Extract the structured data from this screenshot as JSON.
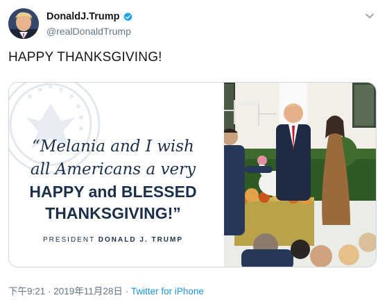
{
  "tweet": {
    "author": {
      "display_name": "DonaldJ.Trump",
      "handle": "@realDonaldTrump",
      "verified": true
    },
    "text": "HAPPY THANKSGIVING!",
    "media": {
      "quote_lines": [
        "“Melania and I wish",
        "all  Americans a very",
        "HAPPY and BLESSED",
        "THANKSGIVING!”"
      ],
      "attribution_prefix": "PRESIDENT ",
      "attribution_name": "DONALD J. TRUMP"
    },
    "timestamp": "下午9:21 · 2019年11月28日 · ",
    "source": "Twitter for iPhone"
  },
  "icons": {
    "verified": "verified-badge-icon",
    "caret": "chevron-down-icon"
  },
  "colors": {
    "text_primary": "#14171a",
    "text_secondary": "#657786",
    "link": "#1b95e0",
    "verified": "#1da1f2",
    "quote_navy": "#1c2f4a"
  }
}
